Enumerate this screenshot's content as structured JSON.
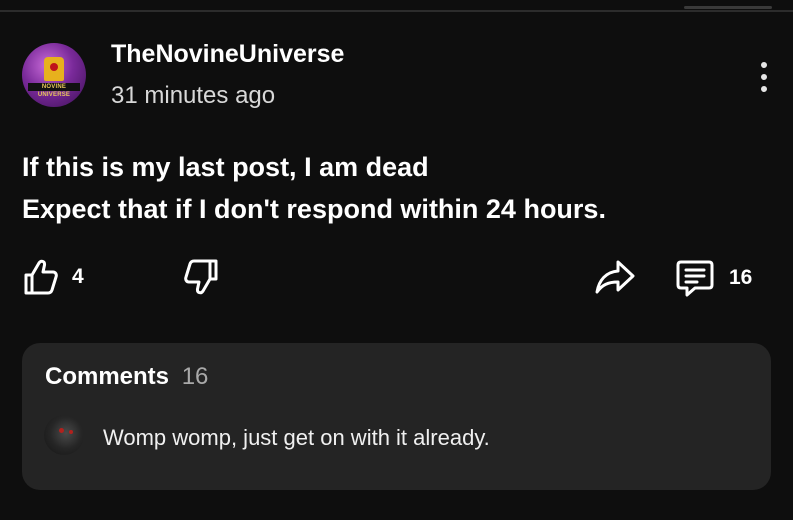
{
  "post": {
    "author": "TheNovineUniverse",
    "avatar_banner": "NOVINE UNIVERSE",
    "timestamp": "31 minutes ago",
    "body_line1": "If this is my last post, I am dead",
    "body_line2": "Expect that if I don't respond within 24 hours."
  },
  "actions": {
    "like_count": "4",
    "comment_count": "16"
  },
  "comments": {
    "title": "Comments",
    "count": "16",
    "preview_text": "Womp womp, just get on with it already."
  },
  "icons": {
    "like": "thumbs-up-icon",
    "dislike": "thumbs-down-icon",
    "share": "share-arrow-icon",
    "comment": "comment-bubble-icon",
    "more": "more-vertical-icon"
  },
  "colors": {
    "background": "#0e0e0e",
    "panel": "#242424",
    "text": "#ffffff",
    "muted": "#a9a9a9"
  }
}
